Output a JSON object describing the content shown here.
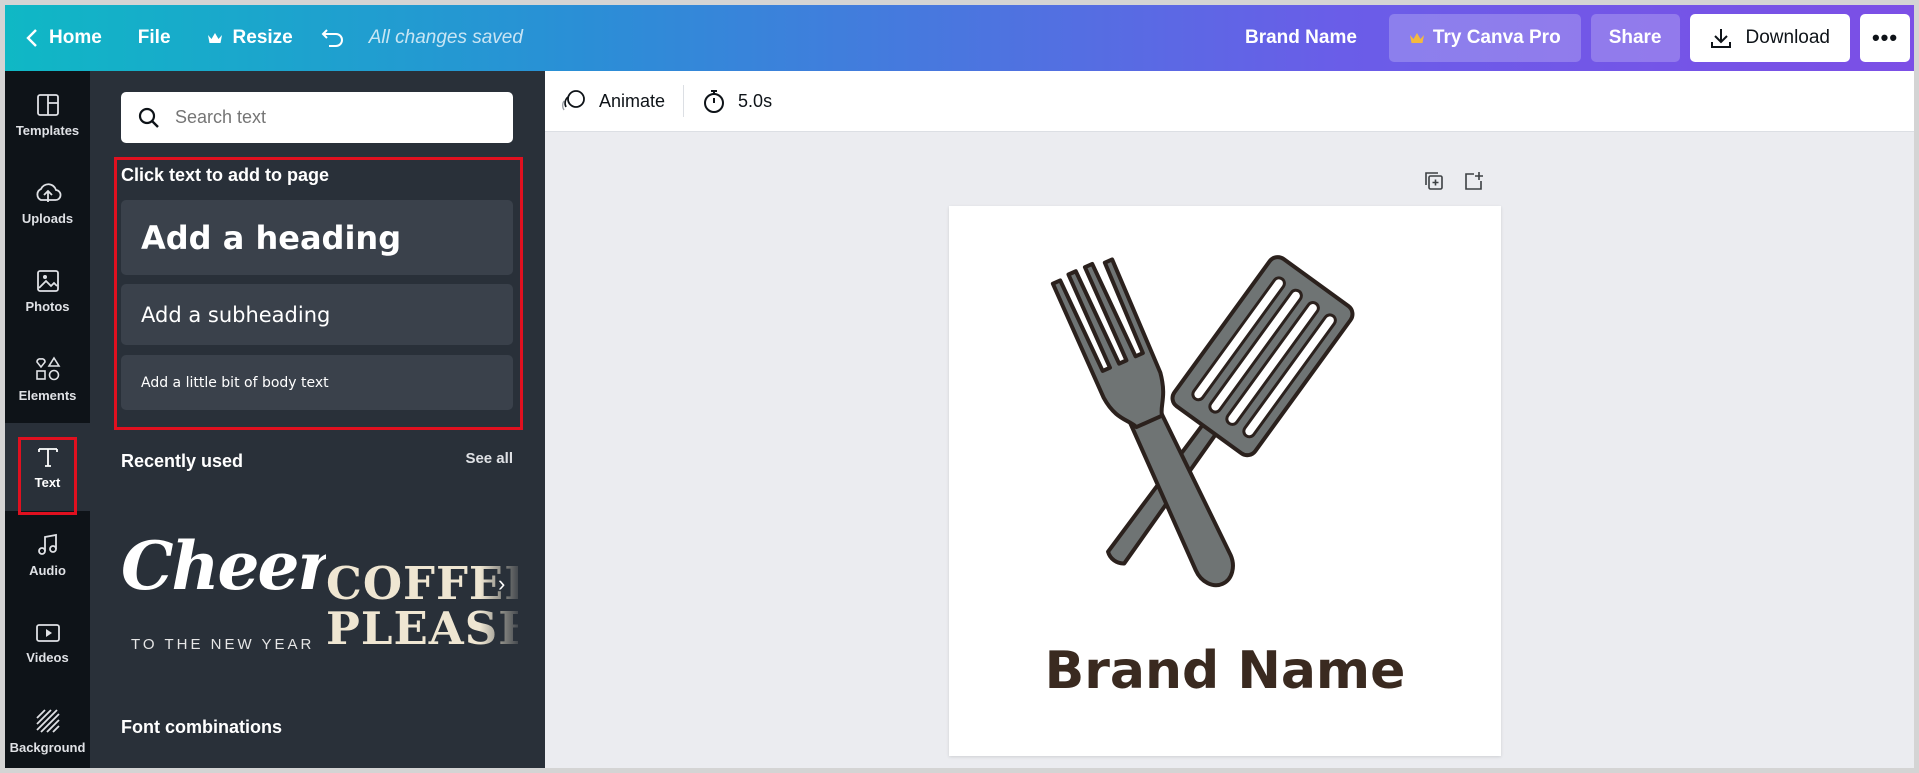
{
  "topbar": {
    "home_label": "Home",
    "file_label": "File",
    "resize_label": "Resize",
    "saved_status": "All changes saved",
    "brand_name": "Brand Name",
    "pro_label": "Try Canva Pro",
    "share_label": "Share",
    "download_label": "Download",
    "more_label": "•••"
  },
  "leftnav": {
    "items": [
      {
        "label": "Templates",
        "icon": "templates-icon"
      },
      {
        "label": "Uploads",
        "icon": "upload-cloud-icon"
      },
      {
        "label": "Photos",
        "icon": "photo-icon"
      },
      {
        "label": "Elements",
        "icon": "elements-shapes-icon"
      },
      {
        "label": "Text",
        "icon": "text-T-icon",
        "active": true
      },
      {
        "label": "Audio",
        "icon": "music-note-icon"
      },
      {
        "label": "Videos",
        "icon": "video-play-icon"
      },
      {
        "label": "Background",
        "icon": "background-stripes-icon"
      }
    ]
  },
  "panel": {
    "search_placeholder": "Search text",
    "click_label": "Click text to add to page",
    "heading_label": "Add a heading",
    "subheading_label": "Add a subheading",
    "body_label": "Add a little bit of body text",
    "recent_title": "Recently used",
    "see_all": "See all",
    "recent": [
      {
        "line1": "Cheers",
        "line2": "TO THE NEW YEAR"
      },
      {
        "line1": "COFFEE",
        "line2": "PLEASE"
      }
    ],
    "combos_title": "Font combinations"
  },
  "toolbar": {
    "animate_label": "Animate",
    "duration_label": "5.0s"
  },
  "design": {
    "brand_text": "Brand Name",
    "colors": {
      "utensil_fill": "#6f7474",
      "outline": "#2b211d",
      "text": "#3a2a20"
    }
  },
  "colors": {
    "highlight": "#e0101f",
    "panel": "#293039",
    "nav": "#0e1318"
  }
}
